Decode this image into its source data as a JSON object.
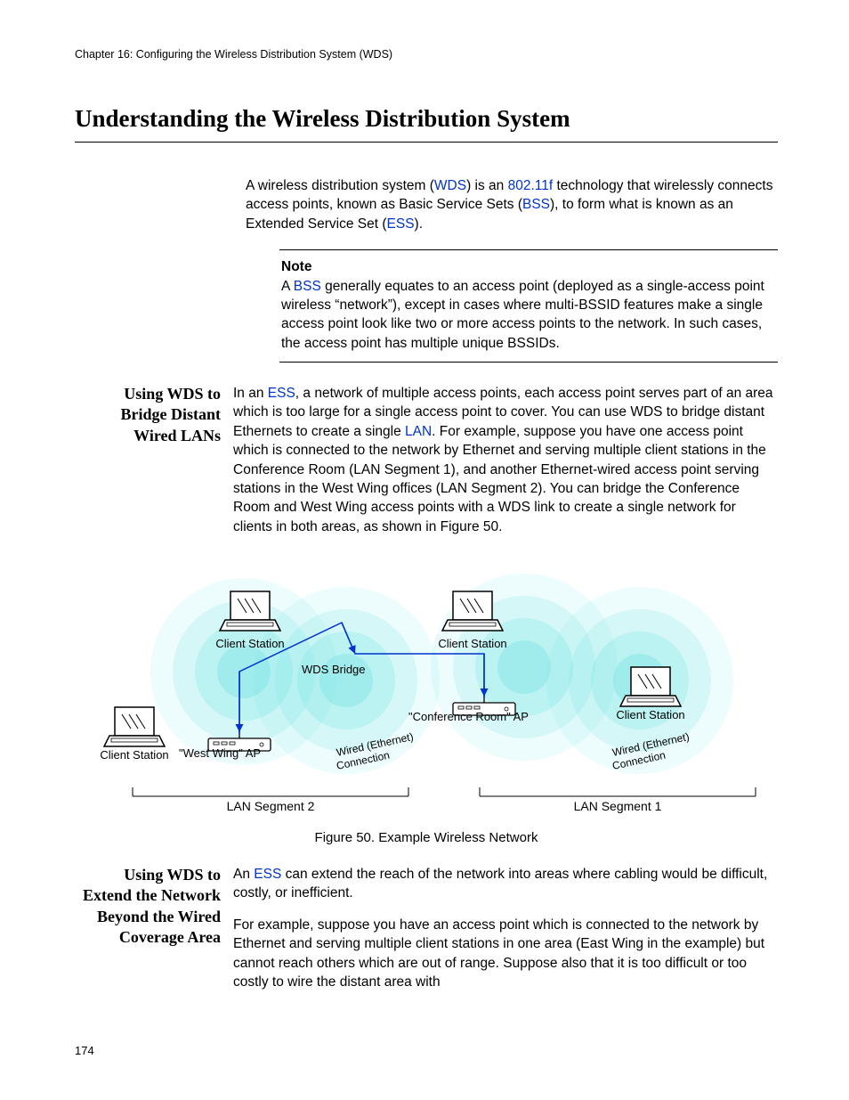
{
  "header": {
    "running": "Chapter 16: Configuring the Wireless Distribution System (WDS)"
  },
  "title": "Understanding the Wireless Distribution System",
  "intro": {
    "pre": "A wireless distribution system (",
    "wds": "WDS",
    "mid1": ") is an ",
    "ieee": "802.11f",
    "mid2": " technology that wirelessly connects access points, known as Basic Service Sets (",
    "bss": "BSS",
    "mid3": "), to form what is known as an Extended Service Set (",
    "ess": "ESS",
    "tail": ")."
  },
  "note": {
    "label": "Note",
    "pre": "A ",
    "bss": "BSS",
    "body": " generally equates to an access point (deployed as a single-access point wireless “network”), except in cases where multi-BSSID features make a single access point look like two or more access points to the network. In such cases, the access point has multiple unique BSSIDs."
  },
  "sec1": {
    "heading": "Using WDS to Bridge Distant Wired LANs",
    "pre": "In an ",
    "ess": "ESS",
    "mid1": ", a network of multiple access points, each access point serves part of an area which is too large for a single access point to cover. You can use WDS to bridge distant Ethernets to create a single ",
    "lan": "LAN",
    "tail": ". For example, suppose you have one access point which is connected to the network by Ethernet and serving multiple client stations in the Conference Room (LAN Segment 1), and another Ethernet-wired access point serving stations in the West Wing offices (LAN Segment 2). You can bridge the Conference Room and West Wing access points with a WDS link to create a single network for clients in both areas, as shown in Figure 50."
  },
  "figure": {
    "caption": "Figure 50. Example Wireless Network",
    "labels": {
      "client": "Client Station",
      "wds": "WDS Bridge",
      "conf_ap": "\"Conference Room\" AP",
      "west_ap": "\"West Wing\" AP",
      "wired1": "Wired (Ethernet)",
      "wired2": "Connection",
      "seg1": "LAN Segment 1",
      "seg2": "LAN Segment 2"
    }
  },
  "sec2": {
    "heading": "Using WDS to Extend the Network Beyond the Wired Coverage Area",
    "p1pre": "An ",
    "p1ess": "ESS",
    "p1": " can extend the reach of the network into areas where cabling would be difficult, costly, or inefficient.",
    "p2": "For example, suppose you have an access point which is connected to the network by Ethernet and serving multiple client stations in one area (East Wing in the example) but cannot reach others which are out of range. Suppose also that it is too difficult or too costly to wire the distant area with"
  },
  "page_number": "174"
}
